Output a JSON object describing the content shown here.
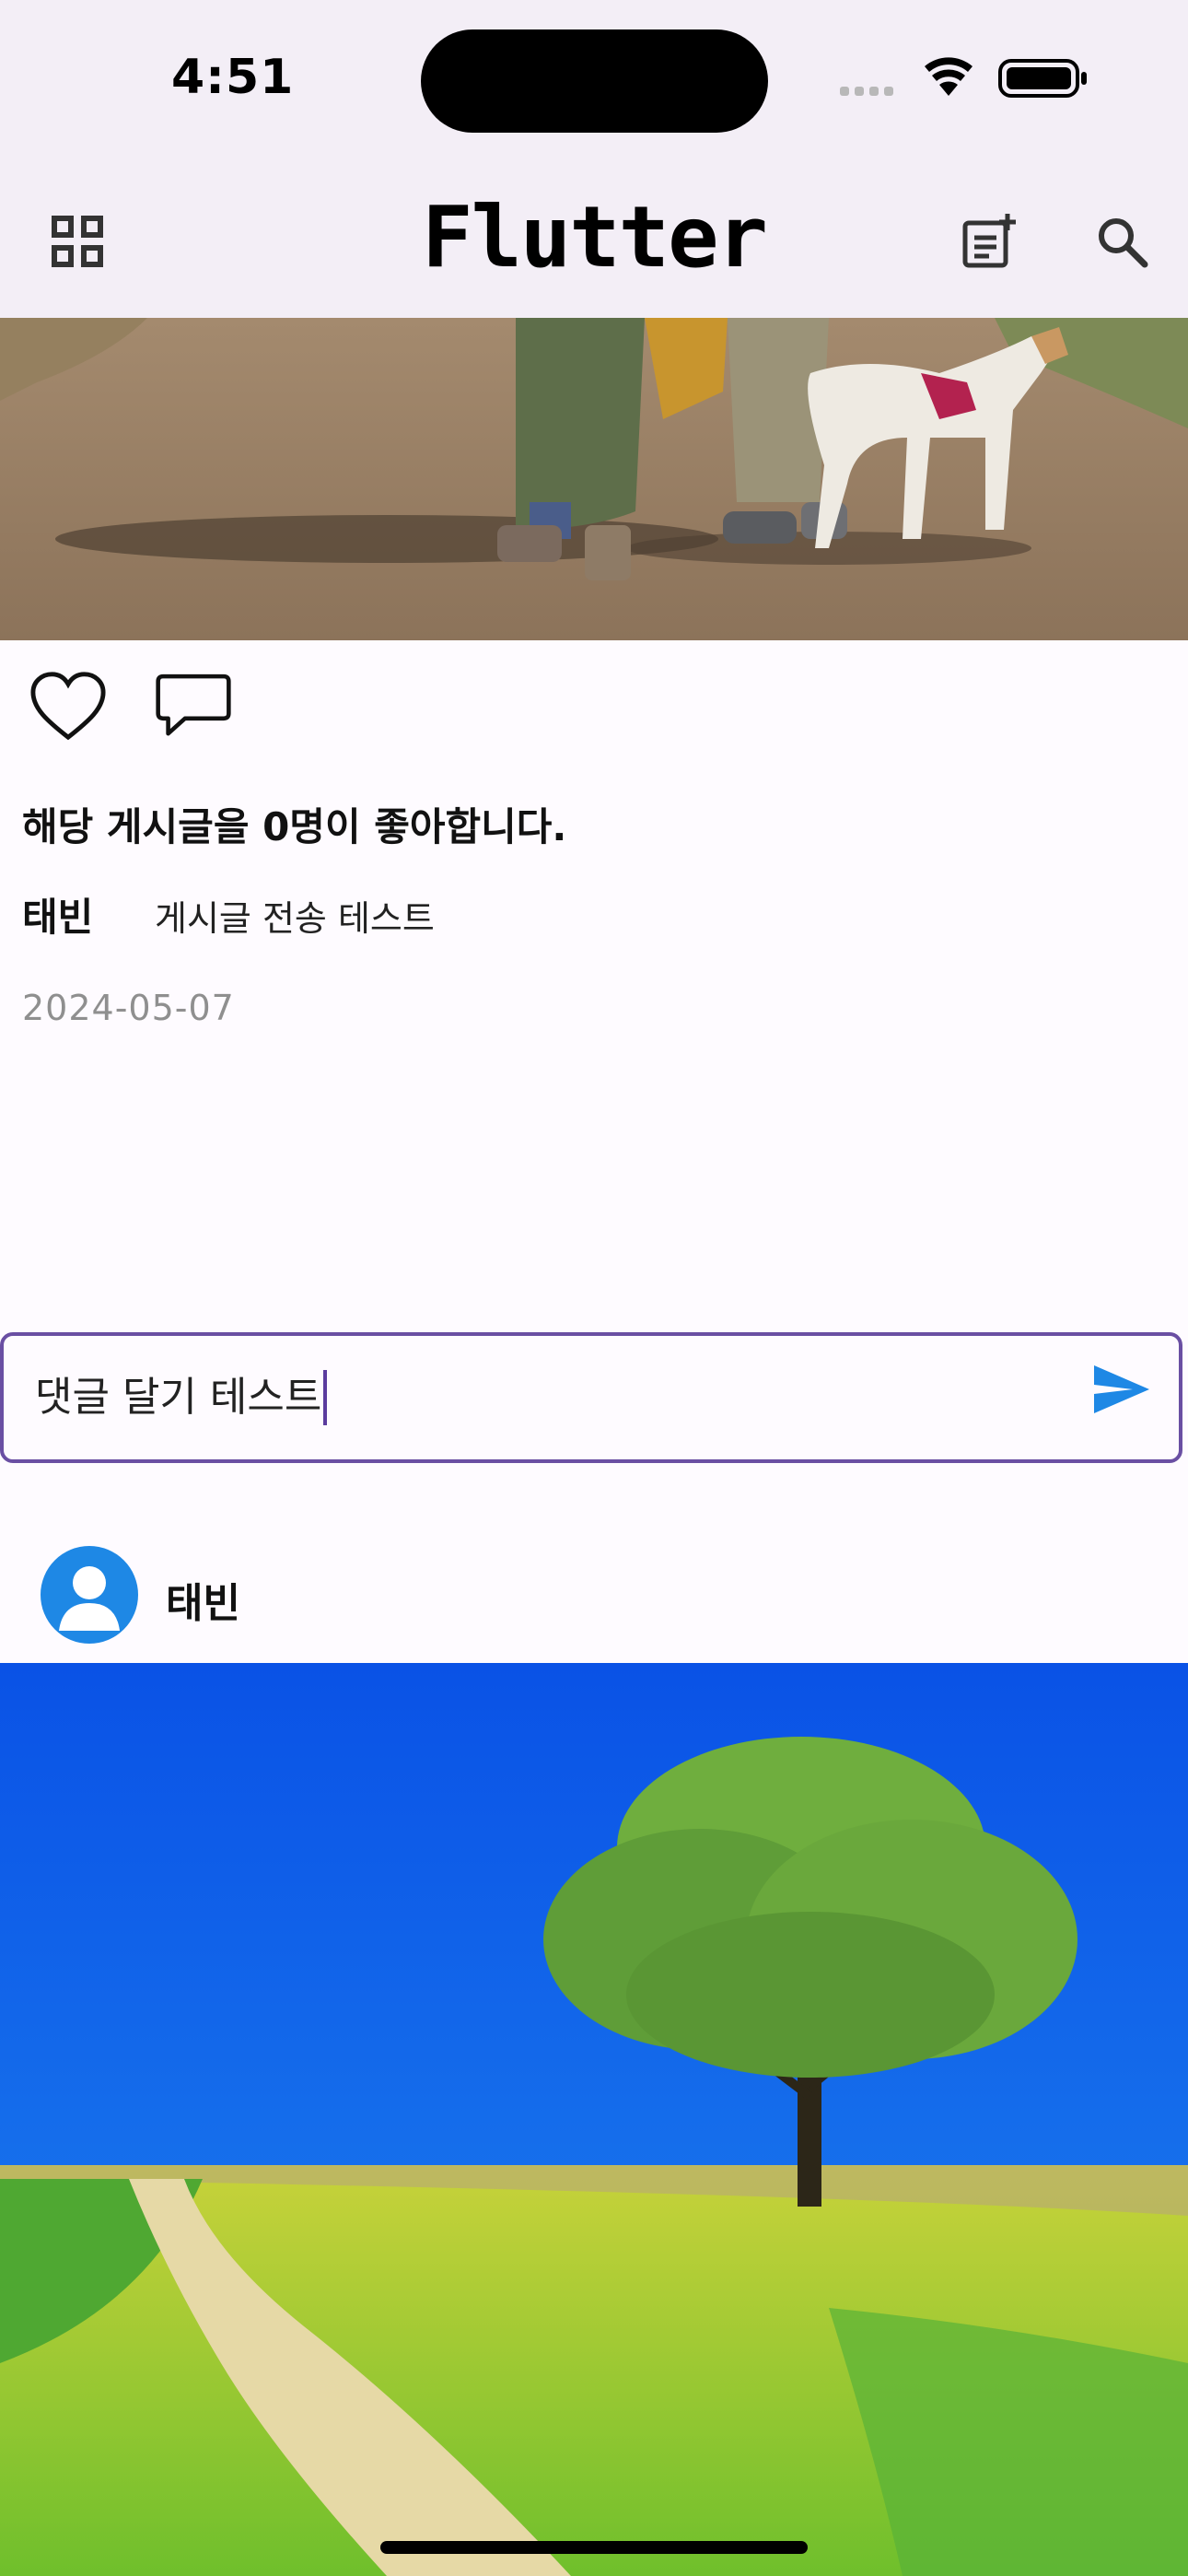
{
  "status_bar": {
    "time": "4:51"
  },
  "app_bar": {
    "title": "Flutter",
    "icons": [
      "grid-icon",
      "new-post-icon",
      "search-icon"
    ]
  },
  "post1": {
    "likes_text": "해당 게시글을 0명이 좋아합니다.",
    "author": "태빈",
    "caption": "게시글 전송 테스트",
    "date": "2024-05-07",
    "icons": [
      "heart-icon",
      "comment-icon"
    ]
  },
  "comment": {
    "value": "댓글 달기 테스트",
    "send_icon": "send-icon",
    "border_color": "#6a4fa3",
    "send_color": "#1e88e5"
  },
  "post2": {
    "author": "태빈",
    "avatar_color": "#1e88e5"
  }
}
